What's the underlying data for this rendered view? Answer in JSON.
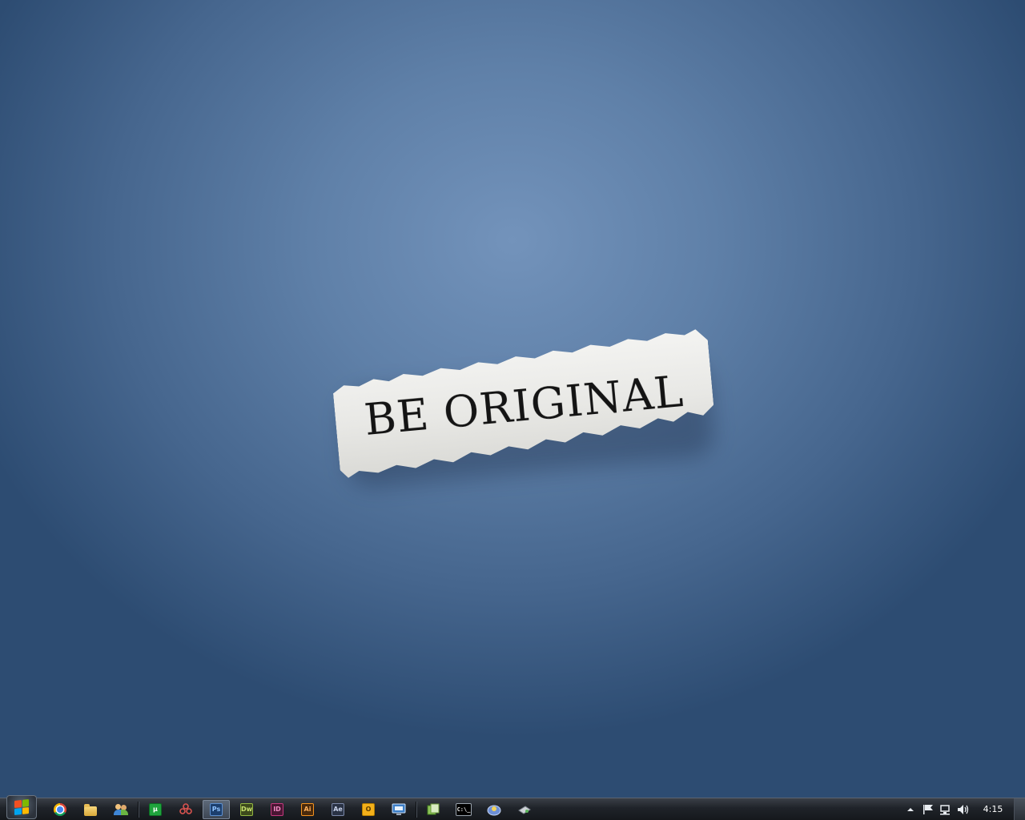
{
  "wallpaper": {
    "text": "BE ORIGINAL"
  },
  "taskbar": {
    "clock": "4:15",
    "items": [
      {
        "name": "chrome",
        "label": ""
      },
      {
        "name": "explorer",
        "label": ""
      },
      {
        "name": "messenger",
        "label": ""
      },
      {
        "name": "utorrent",
        "label": "µ"
      },
      {
        "name": "app-red",
        "label": ""
      },
      {
        "name": "photoshop",
        "label": "Ps"
      },
      {
        "name": "dreamweaver",
        "label": "Dw"
      },
      {
        "name": "indesign",
        "label": "ID"
      },
      {
        "name": "illustrator",
        "label": "Ai"
      },
      {
        "name": "after-effects",
        "label": "Ae"
      },
      {
        "name": "outlook",
        "label": "O"
      },
      {
        "name": "remote",
        "label": ""
      },
      {
        "name": "files",
        "label": ""
      },
      {
        "name": "cmd",
        "label": "C:\\_"
      },
      {
        "name": "app-blue",
        "label": ""
      },
      {
        "name": "app-gray",
        "label": ""
      }
    ]
  },
  "colors": {
    "photoshop": "#2d6db5",
    "dreamweaver": "#93b640",
    "indesign": "#c3387e",
    "illustrator": "#f4931e",
    "after-effects": "#3c4a60",
    "utorrent": "#1fa33d",
    "outlook": "#f3b01a"
  }
}
